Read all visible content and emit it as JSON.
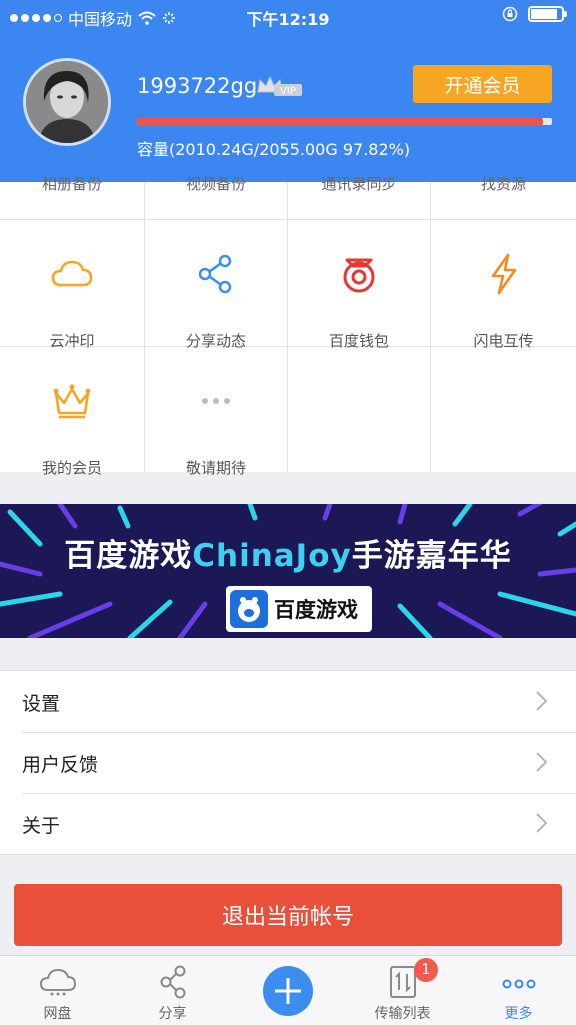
{
  "status_bar": {
    "carrier": "中国移动",
    "time": "下午12:19"
  },
  "profile": {
    "username": "1993722gg",
    "vip_label": "VIP",
    "open_vip_label": "开通会员",
    "quota_text": "容量(2010.24G/2055.00G 97.82%)",
    "quota_percent": 97.82
  },
  "grid": {
    "partial_row": [
      "相册备份",
      "视频备份",
      "通讯录同步",
      "找资源"
    ],
    "items": [
      {
        "label": "云冲印",
        "icon": "cloud-icon"
      },
      {
        "label": "分享动态",
        "icon": "share-icon"
      },
      {
        "label": "百度钱包",
        "icon": "wallet-icon"
      },
      {
        "label": "闪电互传",
        "icon": "lightning-icon"
      },
      {
        "label": "我的会员",
        "icon": "crown-icon"
      },
      {
        "label": "敬请期待",
        "icon": "more-dots-icon"
      }
    ]
  },
  "banner": {
    "title_part1": "百度游戏",
    "title_brand": "ChinaJoy",
    "title_part2": "手游嘉年华",
    "logo_text": "百度游戏"
  },
  "menu": [
    {
      "label": "设置"
    },
    {
      "label": "用户反馈"
    },
    {
      "label": "关于"
    }
  ],
  "logout_label": "退出当前帐号",
  "tabs": [
    {
      "label": "网盘",
      "icon": "cloud-disk-icon"
    },
    {
      "label": "分享",
      "icon": "share-icon"
    },
    {
      "label": "传输列表",
      "icon": "transfer-icon",
      "badge": "1"
    },
    {
      "label": "更多",
      "icon": "more-dots-icon",
      "active": true
    }
  ],
  "colors": {
    "header_blue": "#3b86f0",
    "vip_orange": "#f6a623",
    "logout_red": "#e8503c",
    "active_tab": "#3b86f0"
  }
}
